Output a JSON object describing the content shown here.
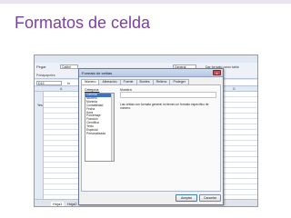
{
  "slide": {
    "title": "Formatos de celda"
  },
  "excel": {
    "ribbon": {
      "paste_label": "Pegar",
      "clipboard_label": "Portapapeles",
      "font_name": "Calibri",
      "style_name": "General",
      "format_label": "Dar formato como tabla"
    },
    "formula_bar": {
      "name_box": "D19",
      "fx": "fx"
    },
    "columns": [
      "A",
      "G"
    ],
    "cell_text": "Yes",
    "sheet_tabs": [
      "Hoja1",
      "Hoja2"
    ]
  },
  "dialog": {
    "title": "Formato de celdas",
    "close_glyph": "x",
    "tabs": [
      "Número",
      "Alineación",
      "Fuente",
      "Bordes",
      "Relleno",
      "Proteger"
    ],
    "active_tab": "Número",
    "category_label": "Categoría:",
    "categories": [
      "General",
      "Número",
      "Moneda",
      "Contabilidad",
      "Fecha",
      "Hora",
      "Porcentaje",
      "Fracción",
      "Científica",
      "Texto",
      "Especial",
      "Personalizada"
    ],
    "selected_category": "General",
    "sample_label": "Muestra",
    "description": "Las celdas con formato general no tienen un formato específico de número.",
    "ok_label": "Aceptar",
    "cancel_label": "Cancelar"
  }
}
